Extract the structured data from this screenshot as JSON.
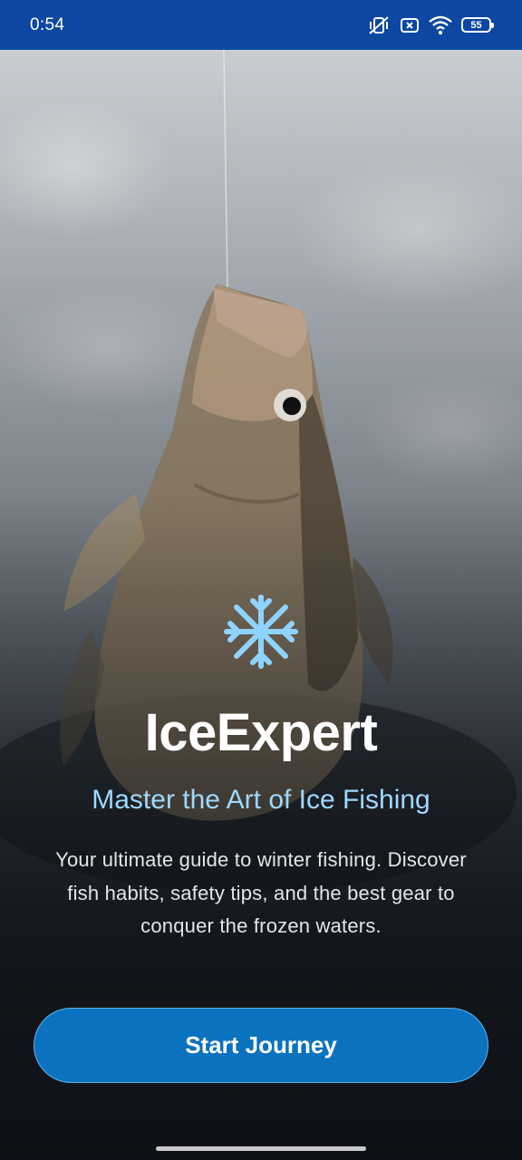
{
  "status_bar": {
    "time": "0:54",
    "battery_level": "55",
    "icons": [
      "vibrate-off-icon",
      "sim-off-icon",
      "wifi-icon",
      "battery-icon"
    ],
    "background_color": "#0d47a1"
  },
  "background": {
    "image": "fish-on-ice-photo"
  },
  "hero": {
    "icon": "snowflake-icon",
    "icon_color": "#8fd3ff",
    "title": "IceExpert",
    "tagline": "Master the Art of Ice Fishing",
    "description": "Your ultimate guide to winter fishing. Discover fish habits, safety tips, and the best gear to conquer the frozen waters."
  },
  "actions": {
    "start_label": "Start Journey",
    "button_color": "#0a72be"
  }
}
